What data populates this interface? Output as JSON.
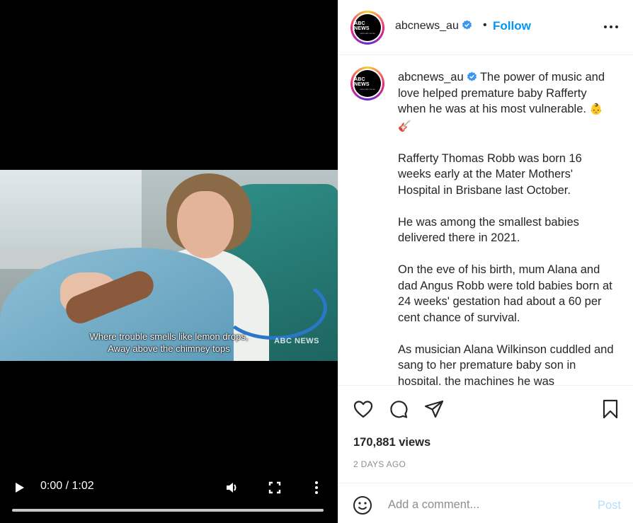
{
  "video": {
    "subtitle_line1": "Where trouble smells like lemon drops,",
    "subtitle_line2": "Away above the chimney tops",
    "watermark": "ABC NEWS",
    "time": "0:00 / 1:02",
    "progress": 0,
    "icons": [
      "play-icon",
      "volume-icon",
      "fullscreen-icon",
      "more-vertical-icon"
    ]
  },
  "header": {
    "avatar_text": "ABC NEWS",
    "avatar_subtext": "news.abc.net.au",
    "username": "abcnews_au",
    "separator": "•",
    "follow_label": "Follow"
  },
  "caption": {
    "username": "abcnews_au",
    "p1": "The power of music and love helped premature baby Rafferty when he was at his most vulnerable.",
    "p1_emoji": "👶 🎸",
    "p2": "Rafferty Thomas Robb was born 16 weeks early at the Mater Mothers' Hospital in Brisbane last October.",
    "p3": "He was among the smallest babies delivered there in 2021.",
    "p4": "On the eve of his birth, mum Alana and dad Angus Robb were told babies born at 24 weeks' gestation had about a 60 per cent chance of survival.",
    "p5": "As musician Alana Wilkinson cuddled and sang to her premature baby son in hospital, the machines he was"
  },
  "stats": {
    "views": "170,881 views",
    "date": "2 DAYS AGO"
  },
  "comment": {
    "placeholder": "Add a comment...",
    "post_label": "Post"
  },
  "colors": {
    "accent": "#0095f6",
    "post_disabled": "#b2dffc",
    "verified": "#3897f0"
  }
}
